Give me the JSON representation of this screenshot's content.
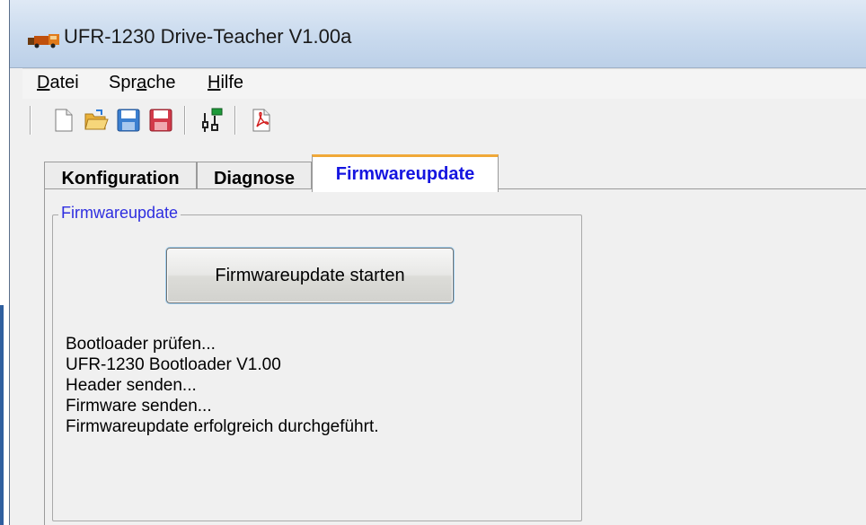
{
  "window": {
    "title": "UFR-1230 Drive-Teacher V1.00a"
  },
  "menubar": {
    "items": [
      {
        "label": "Datei",
        "underline_index": 0
      },
      {
        "label": "Sprache",
        "underline_index": 4
      },
      {
        "label": "Hilfe",
        "underline_index": 0
      }
    ]
  },
  "toolbar": {
    "buttons": [
      {
        "icon": "new-document-icon"
      },
      {
        "icon": "open-folder-icon"
      },
      {
        "icon": "save-blue-icon"
      },
      {
        "icon": "save-red-icon"
      },
      {
        "icon": "connect-device-icon"
      },
      {
        "icon": "pdf-icon"
      }
    ]
  },
  "tabs": [
    {
      "label": "Konfiguration",
      "active": false
    },
    {
      "label": "Diagnose",
      "active": false
    },
    {
      "label": "Firmwareupdate",
      "active": true
    }
  ],
  "firmware": {
    "group_title": "Firmwareupdate",
    "start_button_label": "Firmwareupdate starten",
    "log": [
      "Bootloader prüfen...",
      "UFR-1230 Bootloader V1.00",
      "Header senden...",
      "Firmware senden...",
      "Firmwareupdate erfolgreich durchgeführt."
    ]
  },
  "colors": {
    "active_tab_text": "#1515e0",
    "active_tab_accent": "#f0a838",
    "group_title": "#2e2ee0"
  }
}
